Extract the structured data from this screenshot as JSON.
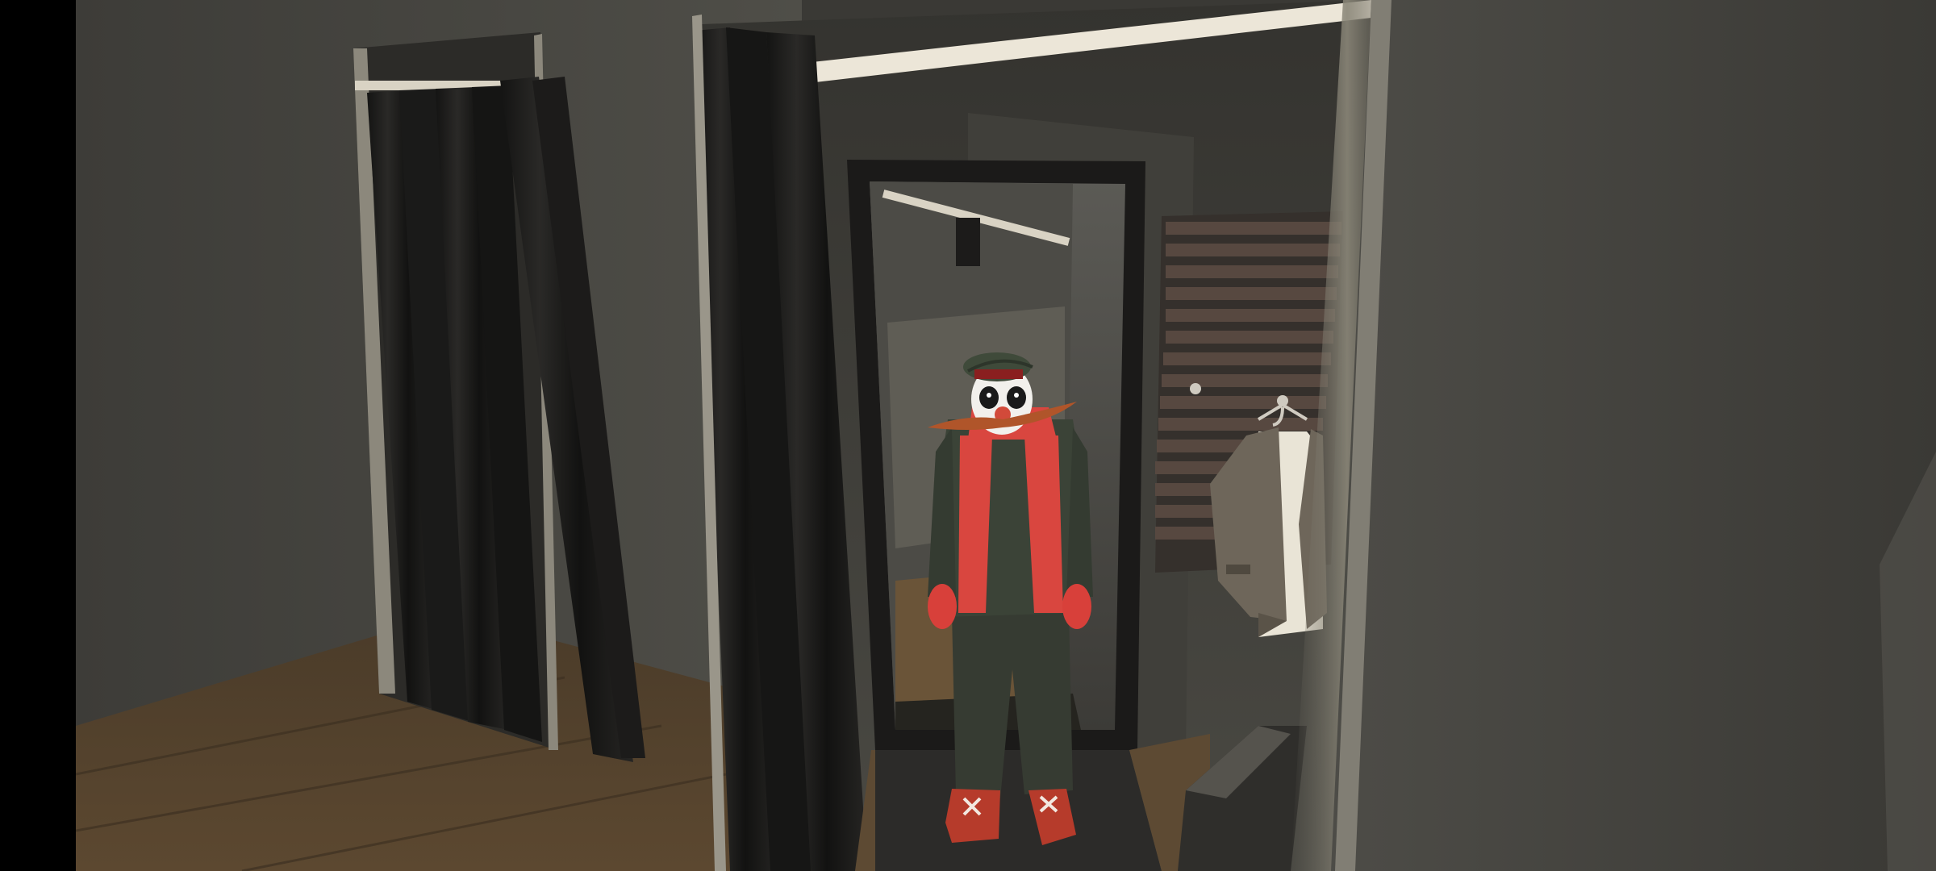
{
  "screen": {
    "letterbox_color": "#000000"
  },
  "scene": {
    "location": "fitting-room",
    "palette": {
      "wall": "#4a4944",
      "wall_shadow": "#2e2d2a",
      "floor": "#5a4630",
      "curtain": "#1d1c1b",
      "rail": "#e8e2d4",
      "frame": "#1a1918",
      "slat": "#4b3e36",
      "jacket": "#6b6356",
      "shirt": "#e9e4d6"
    },
    "objects": [
      "left-changing-booth",
      "left-curtain",
      "right-curtain",
      "curtain-rail",
      "standing-mirror",
      "mirror-reflection",
      "wall-slat-panel",
      "coat-hook",
      "hanging-jacket",
      "floor-mat",
      "bench",
      "right-wall"
    ]
  },
  "character": {
    "role": "player-avatar",
    "outfit": {
      "hat": {
        "item": "flat-cap",
        "color": "#3f4a3a",
        "band_color": "#8a1f1f"
      },
      "face": {
        "item": "clown-mask",
        "color": "#f2f0ec",
        "nose_color": "#d24a3a"
      },
      "mustache": {
        "item": "long-mustache",
        "color": "#b0552a"
      },
      "scarf": {
        "item": "scarf",
        "color": "#d9463f"
      },
      "top": {
        "item": "sweater",
        "color": "#3a4236"
      },
      "pants": {
        "item": "baggy-pants",
        "color": "#353a31"
      },
      "gloves": {
        "item": "gloves",
        "color": "#d8403a"
      },
      "shoes": {
        "item": "sneakers",
        "color": "#b33a2a",
        "lace_color": "#f2e8e0"
      }
    }
  }
}
